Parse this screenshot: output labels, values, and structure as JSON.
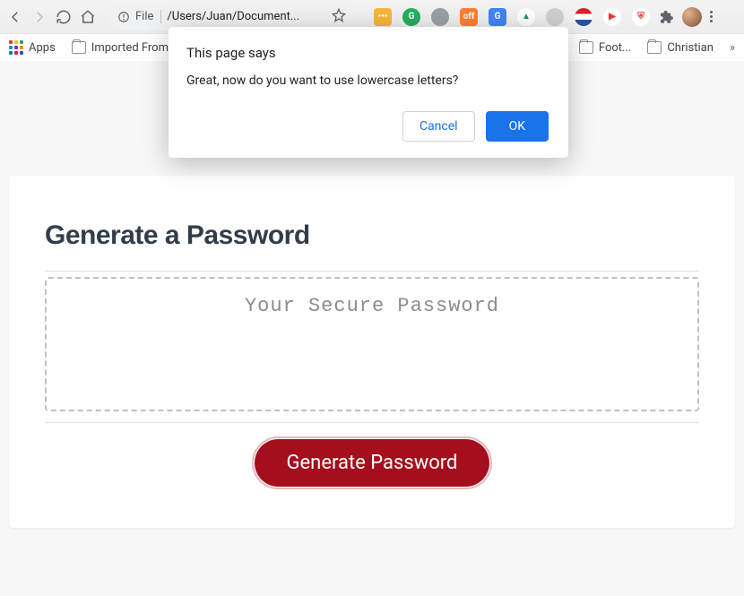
{
  "chrome": {
    "file_label": "File",
    "path": "/Users/Juan/Document...",
    "bookmarks": {
      "apps": "Apps",
      "imported": "Imported From F",
      "foot": "Foot...",
      "christian": "Christian"
    },
    "apps_colors": [
      "#e53935",
      "#fbc02d",
      "#43a047",
      "#1e88e5",
      "#8e24aa",
      "#fb8c00",
      "#00897b",
      "#d81b60",
      "#3949ab"
    ],
    "extensions": [
      {
        "name": "ext-yellow",
        "bg": "#f6b73c",
        "shape": "sq",
        "txt": "•••"
      },
      {
        "name": "ext-green-circle",
        "bg": "#27ae60",
        "txt": "G"
      },
      {
        "name": "ext-grey-circle",
        "bg": "#9aa0a6",
        "txt": ""
      },
      {
        "name": "ext-off",
        "bg": "#ff7f32",
        "shape": "sq",
        "txt": "off",
        "badge": true
      },
      {
        "name": "ext-translate",
        "bg": "#4285f4",
        "shape": "sq",
        "txt": "G"
      },
      {
        "name": "ext-drive",
        "bg": "#ffffff",
        "txt": "▲",
        "fg": "#0f9d58"
      },
      {
        "name": "ext-grey-dot",
        "bg": "#cfcfcf",
        "txt": ""
      },
      {
        "name": "ext-stripes",
        "bg": "linear-gradient(180deg,#d42426 33%,#fff 33%,#fff 66%,#2b4ea0 66%)",
        "txt": ""
      },
      {
        "name": "ext-red-play",
        "bg": "#ffffff",
        "txt": "▶",
        "fg": "#e53935"
      },
      {
        "name": "ext-shield",
        "bg": "#ffffff",
        "txt": "⛨",
        "fg": "#e53935"
      }
    ]
  },
  "dialog": {
    "title": "This page says",
    "message": "Great, now do you want to use lowercase letters?",
    "cancel": "Cancel",
    "ok": "OK"
  },
  "content": {
    "heading": "Generate a Password",
    "placeholder": "Your Secure Password",
    "button": "Generate Password"
  }
}
